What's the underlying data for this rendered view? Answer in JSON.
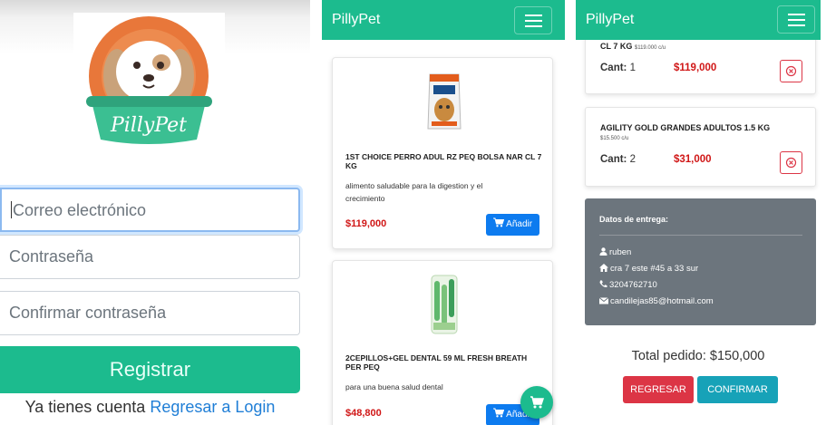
{
  "register": {
    "logo_text": "PillyPet",
    "email_placeholder": "Correo electrónico",
    "password_placeholder": "Contraseña",
    "confirm_placeholder": "Confirmar contraseña",
    "register_button": "Registrar",
    "login_prompt": "Ya tienes cuenta",
    "login_link": "Regresar a Login"
  },
  "catalog": {
    "brand": "PillyPet",
    "products": [
      {
        "name": "1ST CHOICE PERRO ADUL RZ PEQ BOLSA NAR CL 7 KG",
        "description": "alimento saludable para la digestion y el crecimiento",
        "price": "$119,000",
        "button": "Añadir",
        "image_icon": "dog-food-bag-icon"
      },
      {
        "name": "2CEPILLOS+GEL DENTAL 59 ML FRESH BREATH PER PEQ",
        "description": "para una buena salud dental",
        "price": "$48,800",
        "button": "Añadir",
        "image_icon": "toothbrush-kit-icon"
      }
    ],
    "cart_fab_icon": "cart-icon"
  },
  "cart": {
    "brand": "PillyPet",
    "items": [
      {
        "name": "CL 7 KG",
        "unit_price": "$119.000 c/u",
        "qty_label": "Cant:",
        "qty": "1",
        "subtotal": "$119,000"
      },
      {
        "name": "AGILITY GOLD GRANDES ADULTOS 1.5 KG",
        "unit_price": "$15.500 c/u",
        "qty_label": "Cant:",
        "qty": "2",
        "subtotal": "$31,000"
      }
    ],
    "delivery": {
      "title": "Datos de entrega:",
      "name": "ruben",
      "address": "cra 7 este #45 a 33 sur",
      "phone": "3204762710",
      "email": "candilejas85@hotmail.com"
    },
    "total_label": "Total pedido: $150,000",
    "back_button": "REGRESAR",
    "confirm_button": "CONFIRMAR"
  },
  "colors": {
    "brand_green": "#1cbb8e",
    "primary_blue": "#0d7bef",
    "price_red": "#d01616",
    "danger": "#dc3545",
    "info": "#17a2b8",
    "secondary": "#6c757d"
  }
}
